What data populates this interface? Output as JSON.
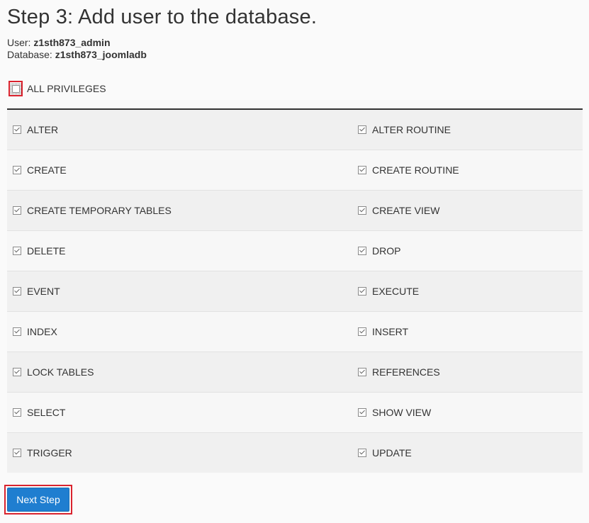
{
  "title": "Step 3: Add user to the database.",
  "user": {
    "label": "User:",
    "value": "z1sth873_admin"
  },
  "database": {
    "label": "Database:",
    "value": "z1sth873_joomladb"
  },
  "all_privileges": {
    "label": "ALL PRIVILEGES",
    "checked": false
  },
  "privileges": [
    {
      "left": "ALTER",
      "right": "ALTER ROUTINE"
    },
    {
      "left": "CREATE",
      "right": "CREATE ROUTINE"
    },
    {
      "left": "CREATE TEMPORARY TABLES",
      "right": "CREATE VIEW"
    },
    {
      "left": "DELETE",
      "right": "DROP"
    },
    {
      "left": "EVENT",
      "right": "EXECUTE"
    },
    {
      "left": "INDEX",
      "right": "INSERT"
    },
    {
      "left": "LOCK TABLES",
      "right": "REFERENCES"
    },
    {
      "left": "SELECT",
      "right": "SHOW VIEW"
    },
    {
      "left": "TRIGGER",
      "right": "UPDATE"
    }
  ],
  "privileges_checked": true,
  "next_button": {
    "label": "Next Step"
  },
  "colors": {
    "accent": "#1f7ed0",
    "highlight": "#d9232e",
    "text": "#333333",
    "background": "#fafafa"
  }
}
